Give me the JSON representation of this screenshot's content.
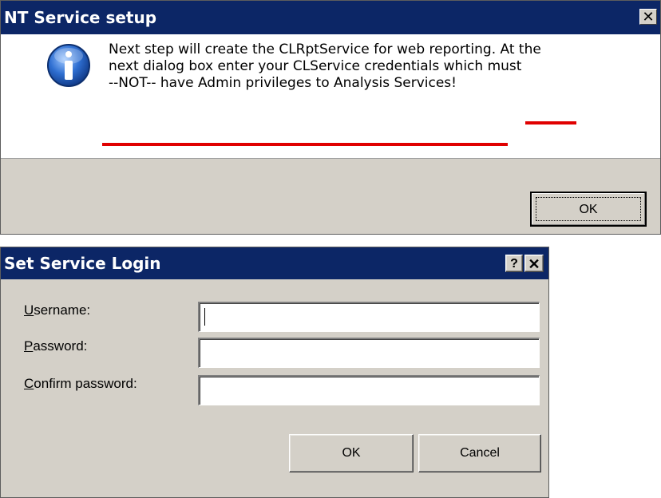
{
  "colors": {
    "titlebar": "#0c2666",
    "dialog_bg": "#d4d0c8",
    "underline_accent": "#e00000"
  },
  "nt_dialog": {
    "title": "NT Service setup",
    "close_glyph": "✕",
    "icon": "info-icon",
    "message_lines": [
      "Next step will create the CLRptService for web reporting.  At the",
      "next dialog box enter your CLService credentials which must",
      "--NOT-- have Admin privileges to Analysis Services!"
    ],
    "ok_label": "OK"
  },
  "login_dialog": {
    "title": "Set Service Login",
    "help_glyph": "?",
    "close_glyph": "✕",
    "username": {
      "mnemonic": "U",
      "rest": "sername:",
      "value": ""
    },
    "password": {
      "mnemonic": "P",
      "rest": "assword:",
      "value": ""
    },
    "confirm_password": {
      "mnemonic": "C",
      "rest": "onfirm password:",
      "value": ""
    },
    "ok_label": "OK",
    "cancel_label": "Cancel"
  }
}
